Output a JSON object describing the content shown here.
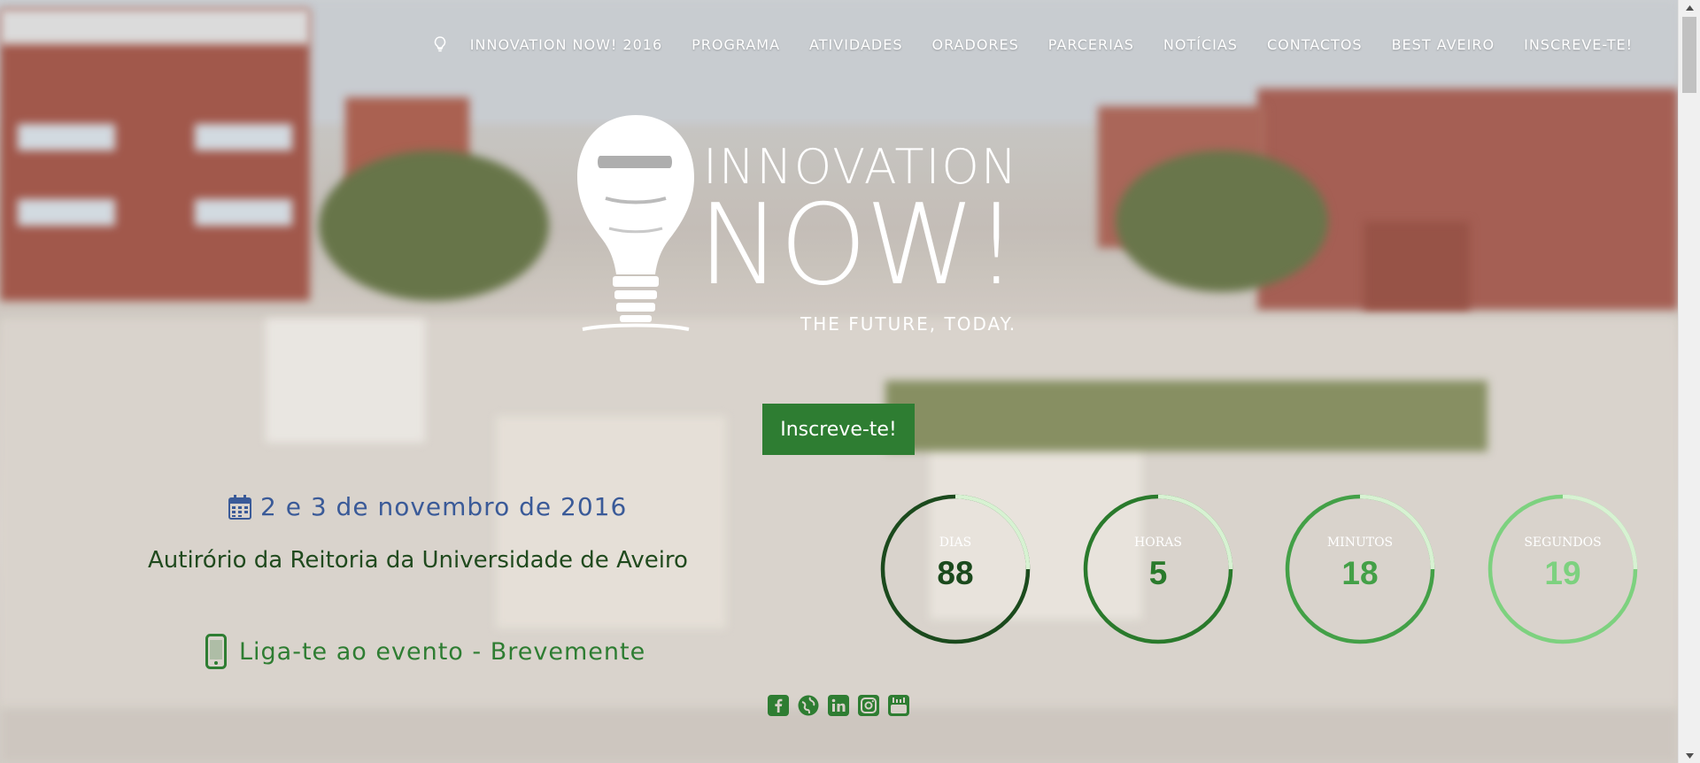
{
  "nav": {
    "items": [
      "INNOVATION NOW! 2016",
      "PROGRAMA",
      "ATIVIDADES",
      "ORADORES",
      "PARCERIAS",
      "NOTÍCIAS",
      "CONTACTOS",
      "BEST AVEIRO",
      "INSCREVE-TE!"
    ]
  },
  "logo": {
    "word1": "INNOVATION",
    "word2": "NOW!",
    "tagline": "THE FUTURE, TODAY."
  },
  "cta": {
    "label": "Inscreve-te!"
  },
  "event": {
    "date": "2 e 3 de novembro de 2016",
    "venue": "Autirório da Reitoria da Universidade de Aveiro",
    "live": "Liga-te ao evento - Brevemente"
  },
  "countdown": [
    {
      "label": "DIAS",
      "value": "88",
      "progress": 0.25,
      "color": "#1b4a1d"
    },
    {
      "label": "HORAS",
      "value": "5",
      "progress": 0.25,
      "color": "#2a7a2c"
    },
    {
      "label": "MINUTOS",
      "value": "18",
      "progress": 0.25,
      "color": "#43a047"
    },
    {
      "label": "SEGUNDOS",
      "value": "19",
      "progress": 0.25,
      "color": "#7dd17f"
    }
  ],
  "social": [
    "facebook-icon",
    "globe-icon",
    "linkedin-icon",
    "instagram-icon",
    "youtube-icon"
  ],
  "colors": {
    "accent_green": "#2e7d32",
    "date_blue": "#3a5a98",
    "venue_green": "#204a1e",
    "ring_light": "#d7f2d2"
  }
}
